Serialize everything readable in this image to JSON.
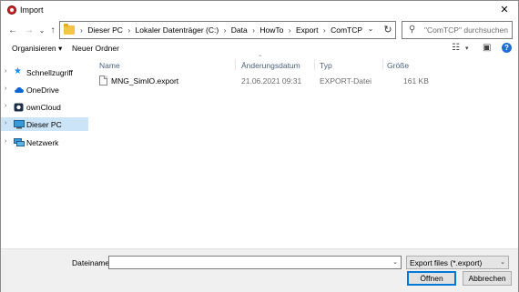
{
  "window": {
    "title": "Import"
  },
  "nav_buttons": {
    "back": "←",
    "forward": "→",
    "recent": "⌄",
    "up": "↑"
  },
  "address": {
    "crumbs": [
      "Dieser PC",
      "Lokaler Datenträger (C:)",
      "Data",
      "HowTo",
      "Export",
      "ComTCP"
    ],
    "separator": "›"
  },
  "search": {
    "placeholder": "\"ComTCP\" durchsuchen"
  },
  "toolbar": {
    "organize_label": "Organisieren ▾",
    "new_folder_label": "Neuer Ordner"
  },
  "nav_pane": {
    "items": [
      {
        "label": "Schnellzugriff",
        "icon": "star-icon",
        "color": "#1e88e5"
      },
      {
        "label": "OneDrive",
        "icon": "cloud-icon",
        "color": "#0a64d2"
      },
      {
        "label": "ownCloud",
        "icon": "owncloud-icon",
        "color": "#1d2d44"
      },
      {
        "label": "Dieser PC",
        "icon": "computer-icon",
        "color": "#3a9ad9",
        "selected": true
      },
      {
        "label": "Netzwerk",
        "icon": "network-icon",
        "color": "#3a9ad9"
      }
    ]
  },
  "columns": {
    "name": "Name",
    "date": "Änderungsdatum",
    "type": "Typ",
    "size": "Größe"
  },
  "files": [
    {
      "name": "MNG_SimIO.export",
      "date": "21.06.2021 09:31",
      "type": "EXPORT-Datei",
      "size": "161 KB"
    }
  ],
  "bottom": {
    "filename_label": "Dateiname:",
    "filename_value": "",
    "filetype_value": "Export files (*.export)",
    "open_label": "Öffnen",
    "cancel_label": "Abbrechen"
  }
}
